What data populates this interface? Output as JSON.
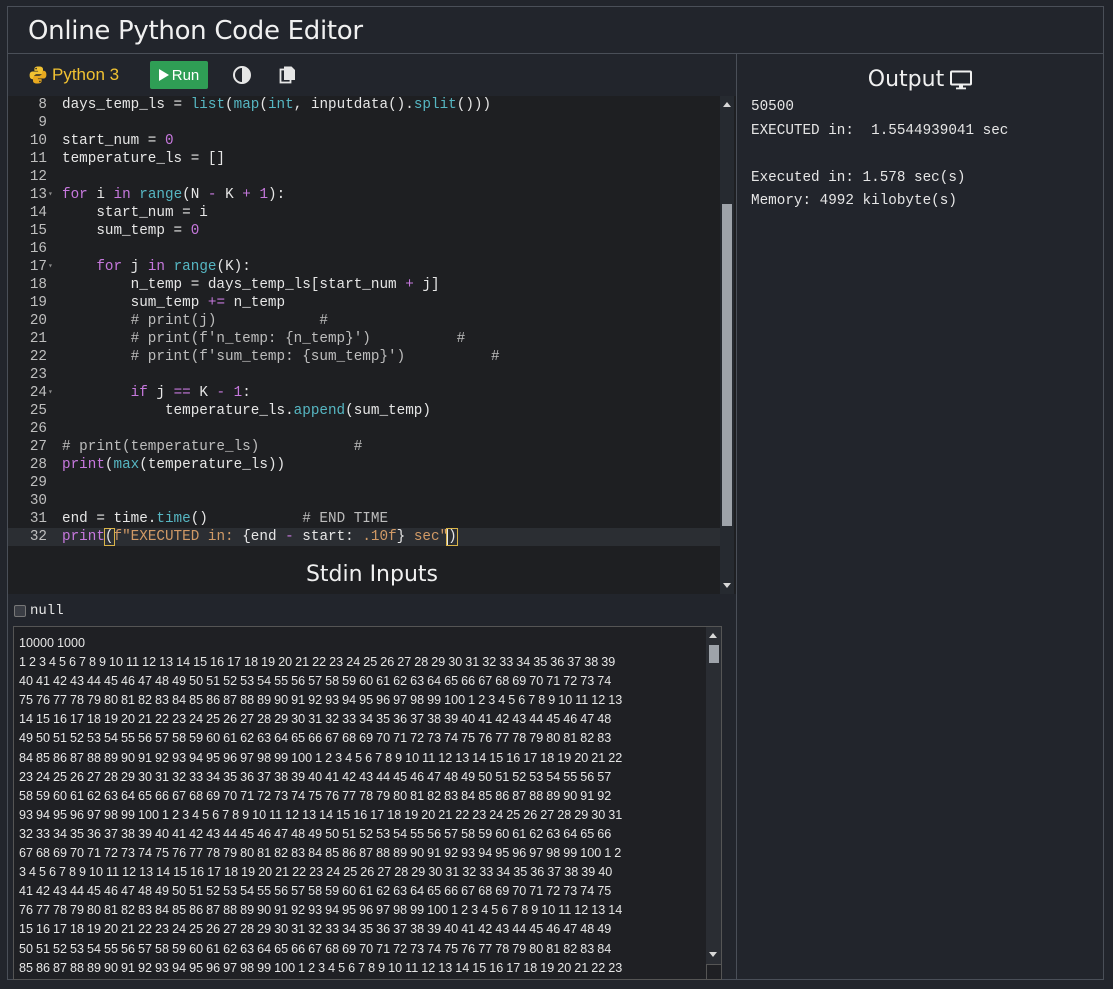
{
  "app": {
    "title": "Online Python Code Editor"
  },
  "toolbar": {
    "language": "Python 3",
    "run_label": "Run"
  },
  "editor": {
    "lines": [
      {
        "n": "8",
        "fold": false,
        "html": "days_temp_ls = <span class=\"b\">list</span>(<span class=\"b\">map</span>(<span class=\"b\">int</span>, inputdata().<span class=\"b\">split</span>()))"
      },
      {
        "n": "9",
        "fold": false,
        "html": ""
      },
      {
        "n": "10",
        "fold": false,
        "html": "start_num = <span class=\"n\">0</span>"
      },
      {
        "n": "11",
        "fold": false,
        "html": "temperature_ls = []"
      },
      {
        "n": "12",
        "fold": false,
        "html": ""
      },
      {
        "n": "13",
        "fold": true,
        "html": "<span class=\"k\">for</span> i <span class=\"k\">in</span> <span class=\"b\">range</span>(N <span class=\"o\">-</span> K <span class=\"o\">+</span> <span class=\"n\">1</span>):"
      },
      {
        "n": "14",
        "fold": false,
        "html": "    start_num = i"
      },
      {
        "n": "15",
        "fold": false,
        "html": "    sum_temp = <span class=\"n\">0</span>"
      },
      {
        "n": "16",
        "fold": false,
        "html": ""
      },
      {
        "n": "17",
        "fold": true,
        "html": "    <span class=\"k\">for</span> j <span class=\"k\">in</span> <span class=\"b\">range</span>(K):"
      },
      {
        "n": "18",
        "fold": false,
        "html": "        n_temp = days_temp_ls[start_num <span class=\"o\">+</span> j]"
      },
      {
        "n": "19",
        "fold": false,
        "html": "        sum_temp <span class=\"o\">+=</span> n_temp"
      },
      {
        "n": "20",
        "fold": false,
        "html": "        <span class=\"cm\"># print(j)            #</span>"
      },
      {
        "n": "21",
        "fold": false,
        "html": "        <span class=\"cm\"># print(f'n_temp: {n_temp}')          #</span>"
      },
      {
        "n": "22",
        "fold": false,
        "html": "        <span class=\"cm\"># print(f'sum_temp: {sum_temp}')          #</span>"
      },
      {
        "n": "23",
        "fold": false,
        "html": ""
      },
      {
        "n": "24",
        "fold": true,
        "html": "        <span class=\"k\">if</span> j <span class=\"o\">==</span> K <span class=\"o\">-</span> <span class=\"n\">1</span>:"
      },
      {
        "n": "25",
        "fold": false,
        "html": "            temperature_ls.<span class=\"b\">append</span>(sum_temp)"
      },
      {
        "n": "26",
        "fold": false,
        "html": ""
      },
      {
        "n": "27",
        "fold": false,
        "html": "<span class=\"cm\"># print(temperature_ls)           #</span>"
      },
      {
        "n": "28",
        "fold": false,
        "html": "<span class=\"k\">print</span>(<span class=\"b\">max</span>(temperature_ls))"
      },
      {
        "n": "29",
        "fold": false,
        "html": ""
      },
      {
        "n": "30",
        "fold": false,
        "html": ""
      },
      {
        "n": "31",
        "fold": false,
        "html": "end = time.<span class=\"b\">time</span>()           <span class=\"cm\"># END TIME</span>"
      },
      {
        "n": "32",
        "fold": false,
        "active": true,
        "html": "<span class=\"k\">print</span><span class=\"bracket\">(</span><span class=\"s\">f\"EXECUTED in: </span>{end <span class=\"o\">-</span> start: <span class=\"sp\">.10f</span>}<span class=\"s\"> sec\"</span><span class=\"bracket caret\">)</span>"
      }
    ]
  },
  "stdin": {
    "title": "Stdin Inputs",
    "null_label": "null",
    "text": "10000 1000\n1 2 3 4 5 6 7 8 9 10 11 12 13 14 15 16 17 18 19 20 21 22 23 24 25 26 27 28 29 30 31 32 33 34 35 36 37 38 39\n40 41 42 43 44 45 46 47 48 49 50 51 52 53 54 55 56 57 58 59 60 61 62 63 64 65 66 67 68 69 70 71 72 73 74\n75 76 77 78 79 80 81 82 83 84 85 86 87 88 89 90 91 92 93 94 95 96 97 98 99 100 1 2 3 4 5 6 7 8 9 10 11 12 13\n14 15 16 17 18 19 20 21 22 23 24 25 26 27 28 29 30 31 32 33 34 35 36 37 38 39 40 41 42 43 44 45 46 47 48\n49 50 51 52 53 54 55 56 57 58 59 60 61 62 63 64 65 66 67 68 69 70 71 72 73 74 75 76 77 78 79 80 81 82 83\n84 85 86 87 88 89 90 91 92 93 94 95 96 97 98 99 100 1 2 3 4 5 6 7 8 9 10 11 12 13 14 15 16 17 18 19 20 21 22\n23 24 25 26 27 28 29 30 31 32 33 34 35 36 37 38 39 40 41 42 43 44 45 46 47 48 49 50 51 52 53 54 55 56 57\n58 59 60 61 62 63 64 65 66 67 68 69 70 71 72 73 74 75 76 77 78 79 80 81 82 83 84 85 86 87 88 89 90 91 92\n93 94 95 96 97 98 99 100 1 2 3 4 5 6 7 8 9 10 11 12 13 14 15 16 17 18 19 20 21 22 23 24 25 26 27 28 29 30 31\n32 33 34 35 36 37 38 39 40 41 42 43 44 45 46 47 48 49 50 51 52 53 54 55 56 57 58 59 60 61 62 63 64 65 66\n67 68 69 70 71 72 73 74 75 76 77 78 79 80 81 82 83 84 85 86 87 88 89 90 91 92 93 94 95 96 97 98 99 100 1 2\n3 4 5 6 7 8 9 10 11 12 13 14 15 16 17 18 19 20 21 22 23 24 25 26 27 28 29 30 31 32 33 34 35 36 37 38 39 40\n41 42 43 44 45 46 47 48 49 50 51 52 53 54 55 56 57 58 59 60 61 62 63 64 65 66 67 68 69 70 71 72 73 74 75\n76 77 78 79 80 81 82 83 84 85 86 87 88 89 90 91 92 93 94 95 96 97 98 99 100 1 2 3 4 5 6 7 8 9 10 11 12 13 14\n15 16 17 18 19 20 21 22 23 24 25 26 27 28 29 30 31 32 33 34 35 36 37 38 39 40 41 42 43 44 45 46 47 48 49\n50 51 52 53 54 55 56 57 58 59 60 61 62 63 64 65 66 67 68 69 70 71 72 73 74 75 76 77 78 79 80 81 82 83 84\n85 86 87 88 89 90 91 92 93 94 95 96 97 98 99 100 1 2 3 4 5 6 7 8 9 10 11 12 13 14 15 16 17 18 19 20 21 22 23"
  },
  "output": {
    "title": "Output",
    "lines": [
      "50500",
      "EXECUTED in:  1.5544939041 sec",
      "",
      "Executed in: 1.578 sec(s)",
      "Memory: 4992 kilobyte(s)"
    ]
  },
  "icons": {
    "language": "python-logo-icon",
    "run": "play-icon",
    "theme": "contrast-toggle-icon",
    "copy": "copy-icon",
    "output": "monitor-icon"
  },
  "colors": {
    "background": "#22252c",
    "editor_bg": "#1e1f22",
    "accent_run": "#2f9e55",
    "language_text": "#f1c232",
    "keyword": "#c678dd",
    "builtin": "#56b6c2",
    "string": "#d19a66"
  }
}
